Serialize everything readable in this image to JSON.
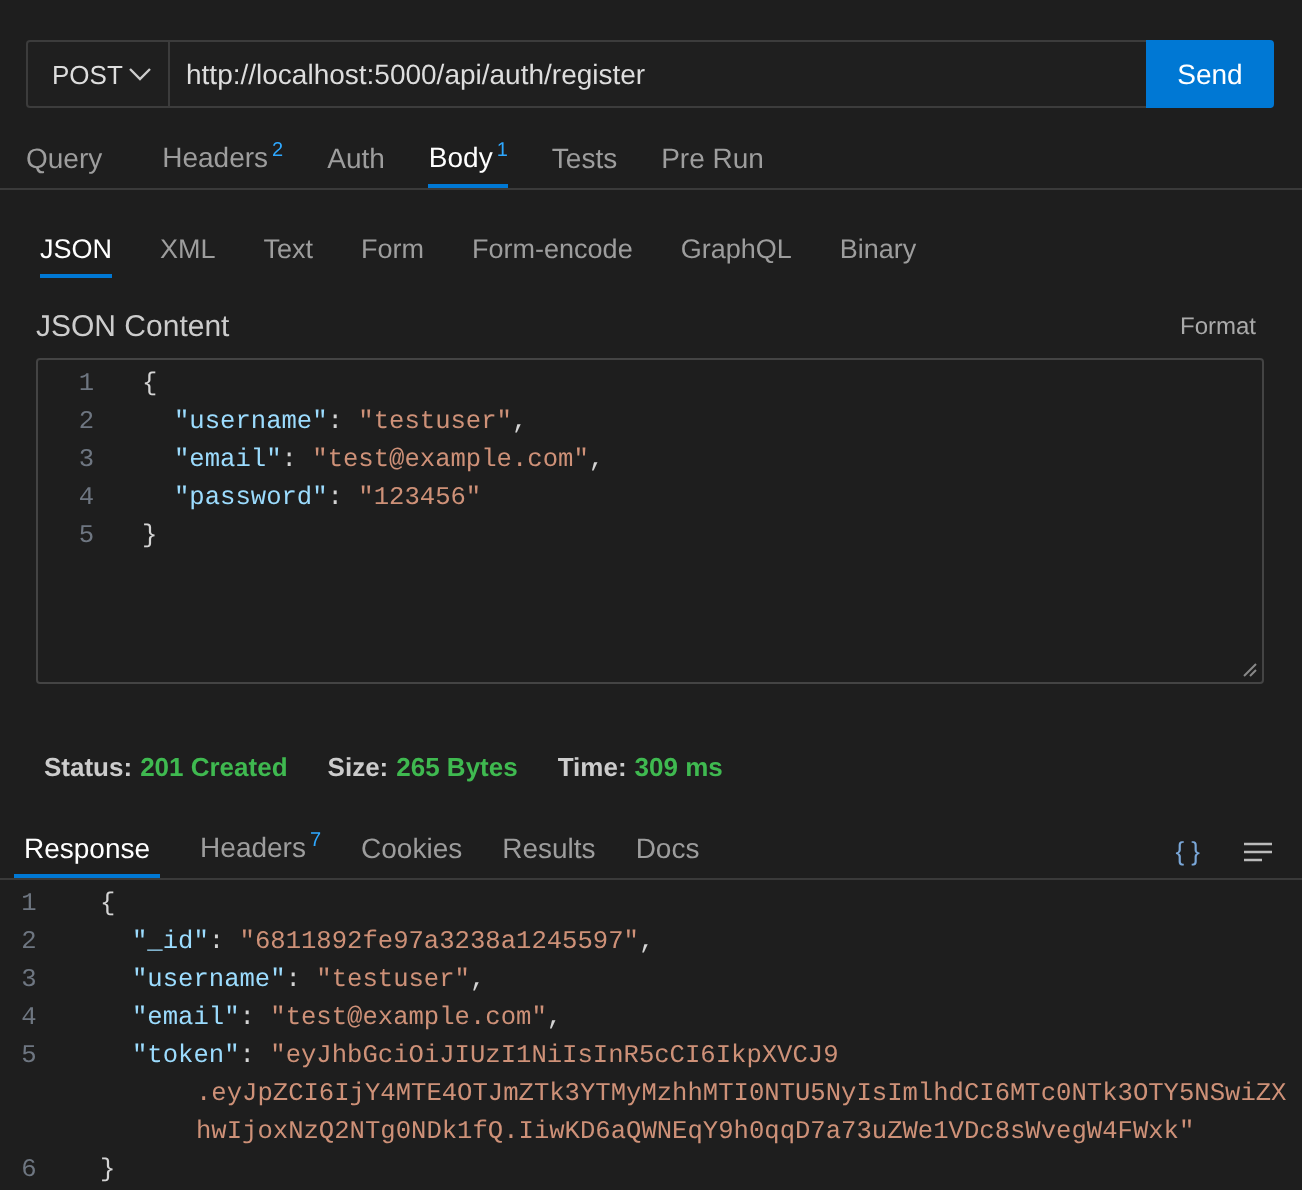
{
  "request": {
    "method": "POST",
    "url": "http://localhost:5000/api/auth/register",
    "send_label": "Send"
  },
  "request_tabs": [
    {
      "label": "Query",
      "selected": false
    },
    {
      "label": "Headers",
      "badge": "2",
      "selected": false
    },
    {
      "label": "Auth",
      "selected": false
    },
    {
      "label": "Body",
      "badge": "1",
      "selected": true
    },
    {
      "label": "Tests",
      "selected": false
    },
    {
      "label": "Pre Run",
      "selected": false
    }
  ],
  "body_tabs": [
    {
      "label": "JSON",
      "selected": true
    },
    {
      "label": "XML",
      "selected": false
    },
    {
      "label": "Text",
      "selected": false
    },
    {
      "label": "Form",
      "selected": false
    },
    {
      "label": "Form-encode",
      "selected": false
    },
    {
      "label": "GraphQL",
      "selected": false
    },
    {
      "label": "Binary",
      "selected": false
    }
  ],
  "json_editor": {
    "title": "JSON Content",
    "format_label": "Format",
    "lines": [
      {
        "number": "1",
        "kind": "brace",
        "text": "{"
      },
      {
        "number": "2",
        "kind": "pair",
        "key": "\"username\"",
        "colon": ":",
        "value_parts": [
          "\"testuser\""
        ],
        "comma": ","
      },
      {
        "number": "3",
        "kind": "pair",
        "key": "\"email\"",
        "colon": ":",
        "value_parts": [
          "\"test@example.com\""
        ],
        "comma": ","
      },
      {
        "number": "4",
        "kind": "pair",
        "key": "\"password\"",
        "colon": ":",
        "value_parts": [
          "\"123456\""
        ]
      },
      {
        "number": "5",
        "kind": "brace",
        "text": "}"
      }
    ]
  },
  "status_bar": [
    {
      "label": "Status:",
      "value": "201 Created"
    },
    {
      "label": "Size:",
      "value": "265 Bytes"
    },
    {
      "label": "Time:",
      "value": "309 ms"
    }
  ],
  "response_tabs": [
    {
      "label": "Response",
      "selected": true
    },
    {
      "label": "Headers",
      "badge": "7",
      "selected": false
    },
    {
      "label": "Cookies",
      "selected": false
    },
    {
      "label": "Results",
      "selected": false
    },
    {
      "label": "Docs",
      "selected": false
    }
  ],
  "response_toolbar": {
    "json_toggle": "{ }"
  },
  "response_lines": [
    {
      "number": "1",
      "kind": "brace",
      "text": "{"
    },
    {
      "number": "2",
      "kind": "pair",
      "key": "\"_id\"",
      "colon": ":",
      "value_parts": [
        "\"6811892fe97a3238a1245597\""
      ],
      "comma": ","
    },
    {
      "number": "3",
      "kind": "pair",
      "key": "\"username\"",
      "colon": ":",
      "value_parts": [
        "\"testuser\""
      ],
      "comma": ","
    },
    {
      "number": "4",
      "kind": "pair",
      "key": "\"email\"",
      "colon": ":",
      "value_parts": [
        "\"test@example.com\""
      ],
      "comma": ","
    },
    {
      "number": "5",
      "kind": "pair",
      "key": "\"token\"",
      "colon": ":",
      "value_parts": [
        "\"eyJhbGciOiJIUzI1NiIsInR5cCI6IkpXVCJ9",
        ".eyJpZCI6IjY4MTE4OTJmZTk3YTMyMzhhMTI0NTU5NyIsImlhdCI6MTc0NTk3OTY5NSwiZX",
        "hwIjoxNzQ2NTg0NDk1fQ.IiwKD6aQWNEqY9h0qqD7a73uZWe1VDc8sWvegW4FWxk\""
      ]
    },
    {
      "number": "6",
      "kind": "brace",
      "text": "}"
    }
  ]
}
